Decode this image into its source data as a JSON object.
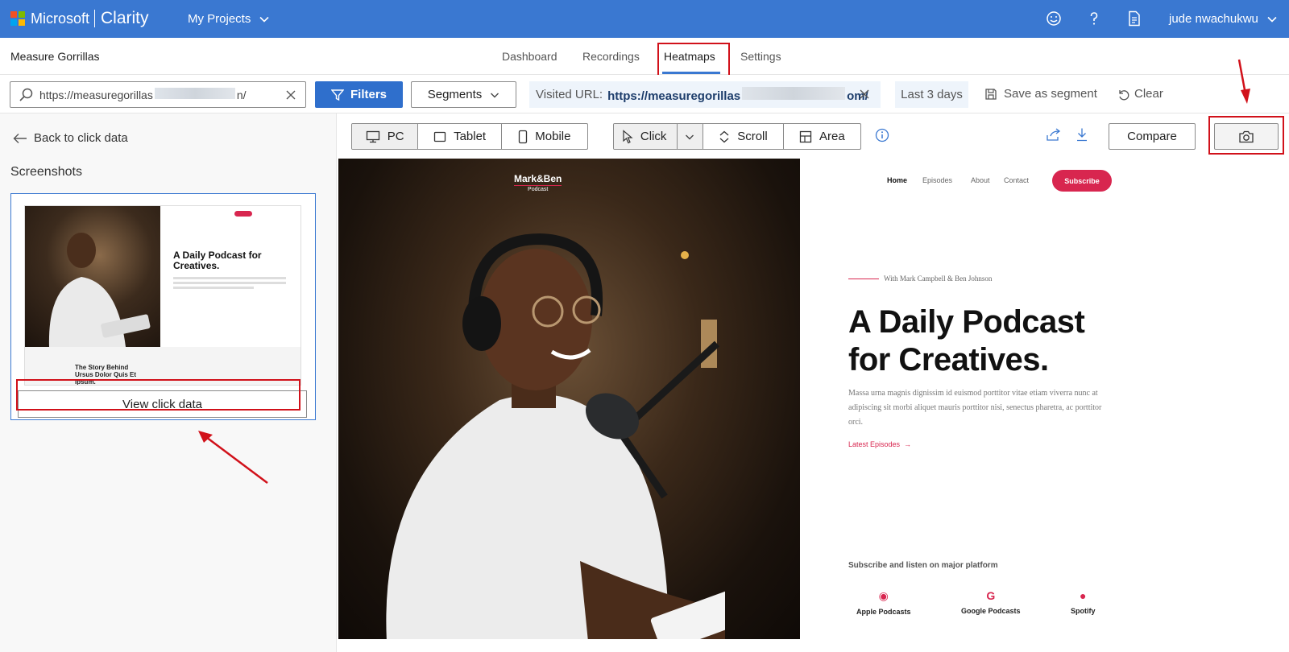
{
  "topbar": {
    "brand": "Microsoft",
    "product": "Clarity",
    "projects_label": "My Projects",
    "user_name": "jude nwachukwu",
    "icons": [
      "smiley-icon",
      "help-icon",
      "document-icon"
    ]
  },
  "subbar": {
    "project_name": "Measure Gorrillas",
    "tabs": [
      {
        "label": "Dashboard"
      },
      {
        "label": "Recordings"
      },
      {
        "label": "Heatmaps",
        "active": true
      },
      {
        "label": "Settings"
      }
    ]
  },
  "filters": {
    "url_value": "https://measuregorillas",
    "url_tail": "n/",
    "filters_label": "Filters",
    "segments_label": "Segments",
    "visited_label": "Visited URL:",
    "visited_value_start": "https://measuregorillas",
    "visited_value_end": "om/",
    "range_label": "Last 3 days",
    "save_segment_label": "Save as segment",
    "clear_label": "Clear"
  },
  "left_panel": {
    "back_label": "Back to click data",
    "screenshots_title": "Screenshots",
    "thumb_heading": "A Daily Podcast for Creatives.",
    "thumb_bottom": "The Story Behind Ursus Dolor Quis Et Ipsum.",
    "view_button_label": "View click data"
  },
  "preview_toolbar": {
    "devices": [
      {
        "label": "PC",
        "selected": true
      },
      {
        "label": "Tablet"
      },
      {
        "label": "Mobile"
      }
    ],
    "modes": [
      {
        "label": "Click",
        "selected": true
      },
      {
        "label": "Scroll"
      },
      {
        "label": "Area"
      }
    ],
    "compare_label": "Compare"
  },
  "preview_site": {
    "logo": "Mark&Ben",
    "logo_sub": "Podcast",
    "nav": [
      "Home",
      "Episodes",
      "About",
      "Contact"
    ],
    "subscribe_label": "Subscribe",
    "kicker": "With Mark Campbell & Ben Johnson",
    "title_line1": "A Daily Podcast",
    "title_line2": "for Creatives.",
    "body": "Massa urna magnis dignissim id euismod porttitor vitae etiam viverra nunc at adipiscing sit morbi aliquet mauris porttitor nisi, senectus pharetra, ac porttitor orci.",
    "latest_link": "Latest Episodes",
    "platforms_title": "Subscribe and listen on major platform",
    "platforms": [
      "Apple Podcasts",
      "Google Podcasts",
      "Spotify"
    ]
  },
  "colors": {
    "topbar": "#3a78d1",
    "primary_button": "#2f6fcc",
    "highlight": "#d1111a",
    "site_accent": "#d8264f"
  }
}
